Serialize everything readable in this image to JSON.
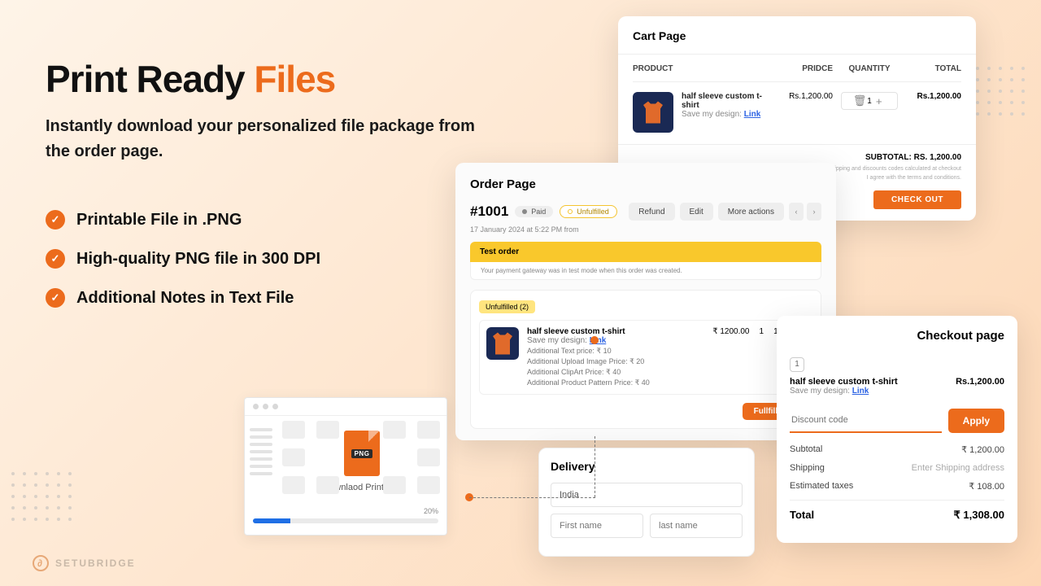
{
  "headline_a": "Print Ready ",
  "headline_b": "Files",
  "subtitle": "Instantly download your personalized file package from the order page.",
  "bullets": [
    "Printable File in .PNG",
    "High-quality PNG file in 300 DPI",
    "Additional Notes in Text File"
  ],
  "filebrowser": {
    "badge": "PNG",
    "caption": "Downlaod Print File",
    "progress_pct": "20%"
  },
  "cart": {
    "title": "Cart Page",
    "head_product": "PRODUCT",
    "head_price": "PRIDCE",
    "head_qty": "QUANTITY",
    "head_total": "TOTAL",
    "item": {
      "name": "half sleeve custom t-shirt",
      "save_label": "Save my design: ",
      "link": "Link",
      "price": "Rs.1,200.00",
      "qty": "1",
      "total": "Rs.1,200.00"
    },
    "subtotal_label": "SUBTOTAL: ",
    "subtotal_value": "RS. 1,200.00",
    "fine1": "Taxes, shipping and discounts codes calculated at checkout",
    "fine2": "I agree with the terms and conditions.",
    "checkout_btn": "CHECK OUT"
  },
  "order": {
    "title": "Order Page",
    "id": "#1001",
    "paid": "Paid",
    "unfulfilled": "Unfulfilled",
    "refund": "Refund",
    "edit": "Edit",
    "more": "More actions",
    "date": "17 January 2024 at 5:22 PM from",
    "banner": "Test order",
    "banner_note": "Your payment gateway was in test mode when this order was created.",
    "badge": "Unfulfilled (2)",
    "item": {
      "name": "half sleeve custom t-shirt",
      "save_label": "Save my design:  ",
      "link": "Link",
      "a1": "Additional Text price: ₹ 10",
      "a2": "Additional Upload Image Price: ₹ 20",
      "a3": "Additional ClipArt Price: ₹ 40",
      "a4": "Additional Product Pattern Price: ₹ 40",
      "price": "₹ 1200.00",
      "qty": "1",
      "total": "1,200.00"
    },
    "fulfill": "Fullfill items"
  },
  "delivery": {
    "title": "Delivery",
    "country": "India",
    "first": "First name",
    "last": "last name"
  },
  "checkout": {
    "title": "Checkout page",
    "qty": "1",
    "name": "half sleeve custom t-shirt",
    "price": "Rs.1,200.00",
    "save_label": "Save my design: ",
    "link": "Link",
    "discount_ph": "Discount code",
    "apply": "Apply",
    "rows": {
      "subtotal_l": "Subtotal",
      "subtotal_v": "₹ 1,200.00",
      "ship_l": "Shipping",
      "ship_v": "Enter Shipping address",
      "tax_l": "Estimated taxes",
      "tax_v": "₹ 108.00",
      "total_l": "Total",
      "total_v": "₹ 1,308.00"
    }
  },
  "brand": "SETUBRIDGE"
}
